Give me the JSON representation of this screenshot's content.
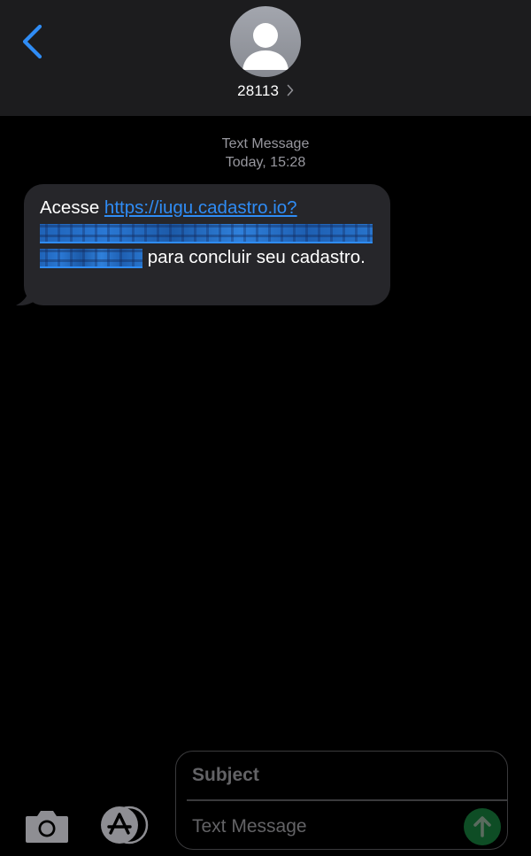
{
  "header": {
    "contact_name": "28113"
  },
  "thread": {
    "service_label": "Text Message",
    "timestamp": "Today, 15:28"
  },
  "message": {
    "text_before": "Acesse ",
    "link_visible": "https://iugu.cadastro.io?",
    "text_after": " para concluir seu cadastro."
  },
  "composer": {
    "subject_placeholder": "Subject",
    "message_placeholder": "Text Message"
  },
  "icons": {
    "back": "chevron-left-icon",
    "avatar": "person-silhouette-icon",
    "details": "chevron-right-icon",
    "camera": "camera-icon",
    "apps": "app-store-icon",
    "send": "arrow-up-icon"
  },
  "colors": {
    "accent_blue": "#2f8cf5",
    "bubble_gray": "#26262a",
    "header_bg": "#1c1c1e",
    "send_green_disabled": "#0e4d25"
  }
}
